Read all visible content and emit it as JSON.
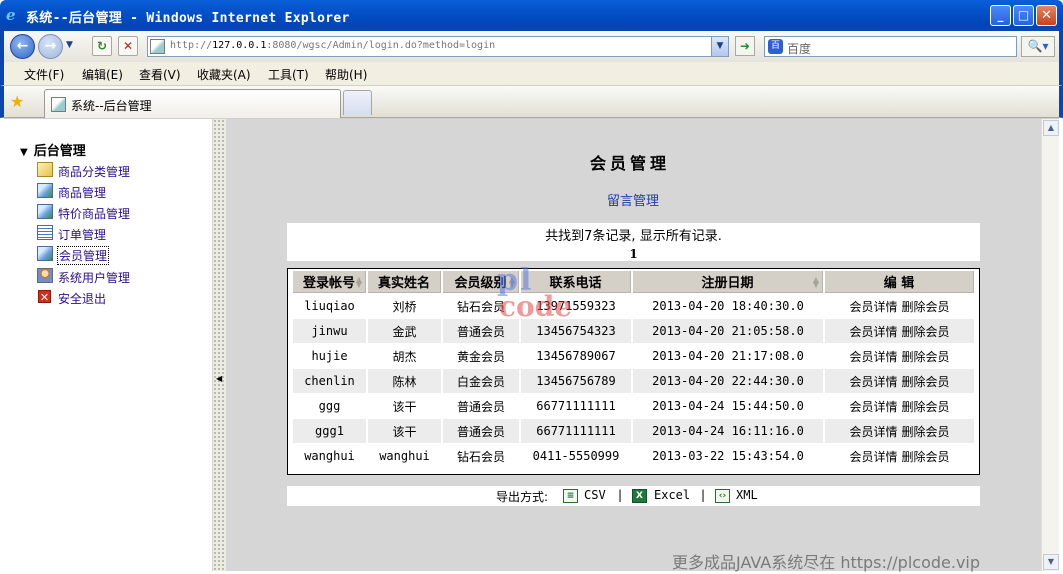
{
  "window": {
    "title": "系统--后台管理 - Windows Internet Explorer",
    "minimize": "_",
    "maximize": "□",
    "close": "✕"
  },
  "address": {
    "url_prefix": "http://",
    "url_host": "127.0.0.1",
    "url_rest": ":8080/wgsc/Admin/login.do?method=login",
    "search_placeholder": "百度"
  },
  "menu": [
    "文件(F)",
    "编辑(E)",
    "查看(V)",
    "收藏夹(A)",
    "工具(T)",
    "帮助(H)"
  ],
  "tab": {
    "label": "系统--后台管理"
  },
  "sidebar": {
    "header": "后台管理",
    "items": [
      {
        "label": "商品分类管理",
        "icon": "category-icon"
      },
      {
        "label": "商品管理",
        "icon": "product-icon"
      },
      {
        "label": "特价商品管理",
        "icon": "special-product-icon"
      },
      {
        "label": "订单管理",
        "icon": "order-icon"
      },
      {
        "label": "会员管理",
        "icon": "member-icon",
        "active": true
      },
      {
        "label": "系统用户管理",
        "icon": "system-user-icon"
      },
      {
        "label": "安全退出",
        "icon": "exit-icon"
      }
    ]
  },
  "main": {
    "title": "会员管理",
    "sub_link": "留言管理",
    "record_info": "共找到7条记录, 显示所有记录.",
    "page_number": "1",
    "columns": [
      "登录帐号",
      "真实姓名",
      "会员级别",
      "联系电话",
      "注册日期",
      "编 辑"
    ],
    "rows": [
      {
        "account": "liuqiao",
        "name": "刘桥",
        "level": "钻石会员",
        "phone": "13971559323",
        "date": "2013-04-20 18:40:30.0"
      },
      {
        "account": "jinwu",
        "name": "金武",
        "level": "普通会员",
        "phone": "13456754323",
        "date": "2013-04-20 21:05:58.0"
      },
      {
        "account": "hujie",
        "name": "胡杰",
        "level": "黄金会员",
        "phone": "13456789067",
        "date": "2013-04-20 21:17:08.0"
      },
      {
        "account": "chenlin",
        "name": "陈林",
        "level": "白金会员",
        "phone": "13456756789",
        "date": "2013-04-20 22:44:30.0"
      },
      {
        "account": "ggg",
        "name": "该干",
        "level": "普通会员",
        "phone": "66771111111",
        "date": "2013-04-24 15:44:50.0"
      },
      {
        "account": "ggg1",
        "name": "该干",
        "level": "普通会员",
        "phone": "66771111111",
        "date": "2013-04-24 16:11:16.0"
      },
      {
        "account": "wanghui",
        "name": "wanghui",
        "level": "钻石会员",
        "phone": "0411-5550999",
        "date": "2013-03-22 15:43:54.0"
      }
    ],
    "action_detail": "会员详情",
    "action_delete": "删除会员",
    "export": {
      "label": "导出方式:",
      "csv": "CSV",
      "excel": "Excel",
      "xml": "XML"
    },
    "watermark_top": "pl",
    "watermark_bottom": "code",
    "footer": "更多成品JAVA系统尽在 https://plcode.vip"
  }
}
